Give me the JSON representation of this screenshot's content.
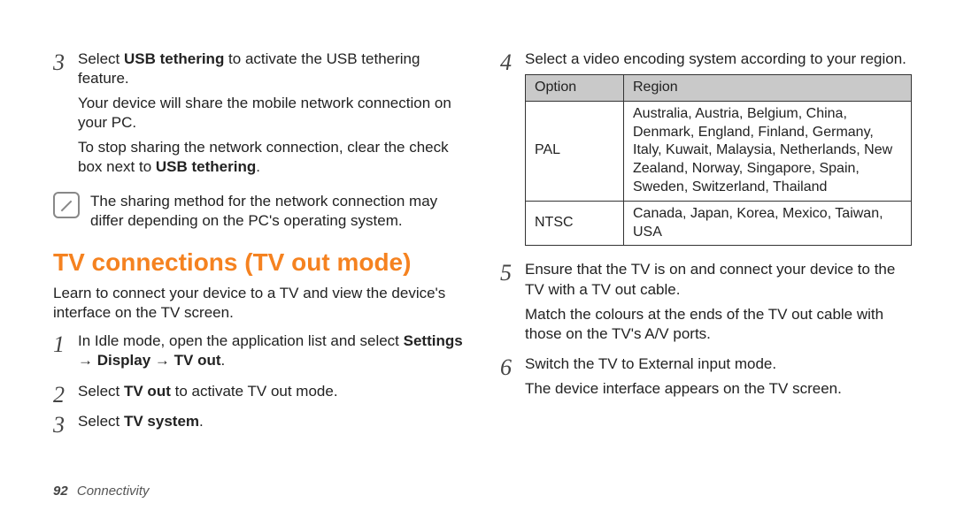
{
  "left": {
    "step3_num": "3",
    "step3_p1_pre": "Select ",
    "step3_p1_bold": "USB tethering",
    "step3_p1_post": " to activate the USB tethering feature.",
    "step3_p2": "Your device will share the mobile network connection on your PC.",
    "step3_p3_pre": "To stop sharing the network connection, clear the check box next to ",
    "step3_p3_bold": "USB tethering",
    "step3_p3_post": ".",
    "note": "The sharing method for the network connection may differ depending on the PC's operating system.",
    "heading": "TV connections (TV out mode)",
    "intro": "Learn to connect your device to a TV and view the device's interface on the TV screen.",
    "s1_num": "1",
    "s1_pre": "In Idle mode, open the application list and select ",
    "s1_bold": "Settings → Display → TV out",
    "s1_post": ".",
    "s2_num": "2",
    "s2_pre": "Select ",
    "s2_bold": "TV out",
    "s2_post": " to activate TV out mode.",
    "s3_num": "3",
    "s3_pre": "Select ",
    "s3_bold": "TV system",
    "s3_post": "."
  },
  "right": {
    "s4_num": "4",
    "s4_text": "Select a video encoding system according to your region.",
    "th_option": "Option",
    "th_region": "Region",
    "r1_opt": "PAL",
    "r1_reg": "Australia, Austria, Belgium, China, Denmark, England, Finland, Germany, Italy, Kuwait, Malaysia, Netherlands, New Zealand, Norway, Singapore, Spain, Sweden, Switzerland, Thailand",
    "r2_opt": "NTSC",
    "r2_reg": "Canada, Japan, Korea, Mexico, Taiwan, USA",
    "s5_num": "5",
    "s5_p1": "Ensure that the TV is on and connect your device to the TV with a TV out cable.",
    "s5_p2": "Match the colours at the ends of the TV out cable with those on the TV's A/V ports.",
    "s6_num": "6",
    "s6_p1": "Switch the TV to External input mode.",
    "s6_p2": "The device interface appears on the TV screen."
  },
  "footer": {
    "page": "92",
    "section": "Connectivity"
  }
}
